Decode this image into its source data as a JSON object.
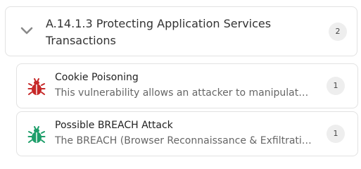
{
  "group": {
    "title": "A.14.1.3 Protecting Application Services Transactions",
    "count": "2",
    "chevron_icon": "chevron-down-icon"
  },
  "items": [
    {
      "title": "Cookie Poisoning",
      "description": "This vulnerability allows an attacker to manipulate cookies",
      "count": "1",
      "icon": "bug-icon",
      "icon_color": "#c62828"
    },
    {
      "title": "Possible BREACH Attack",
      "description": "The BREACH (Browser Reconnaissance & Exfiltration via Adaptive Compression of Hypertext)",
      "count": "1",
      "icon": "bug-icon",
      "icon_color": "#1e9e6a"
    }
  ]
}
